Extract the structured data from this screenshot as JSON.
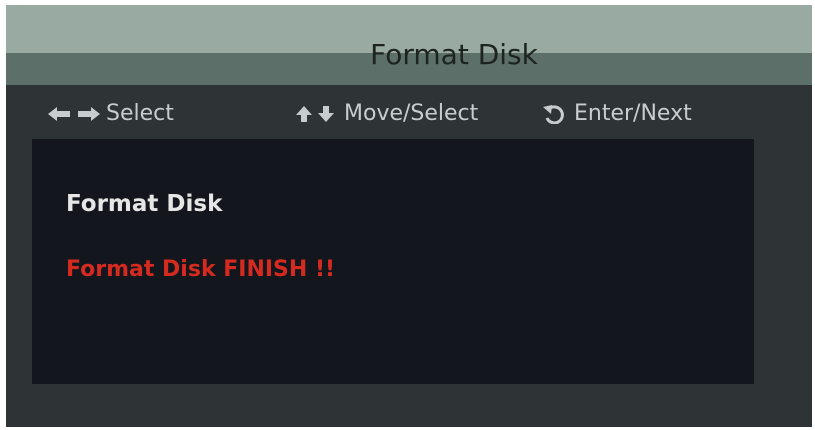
{
  "window": {
    "title": "Format Disk"
  },
  "hints": [
    {
      "icon": "left-right-arrows-icon",
      "label": "Select"
    },
    {
      "icon": "up-down-arrows-icon",
      "label": "Move/Select"
    },
    {
      "icon": "enter-return-icon",
      "label": "Enter/Next"
    }
  ],
  "panel": {
    "heading": "Format Disk",
    "status": "Format Disk FINISH !!",
    "status_color": "#d42a20"
  },
  "colors": {
    "title_bar": "#98aaa1",
    "title_band": "#5d6f69",
    "background": "#2e3336",
    "panel": "#13161d"
  }
}
